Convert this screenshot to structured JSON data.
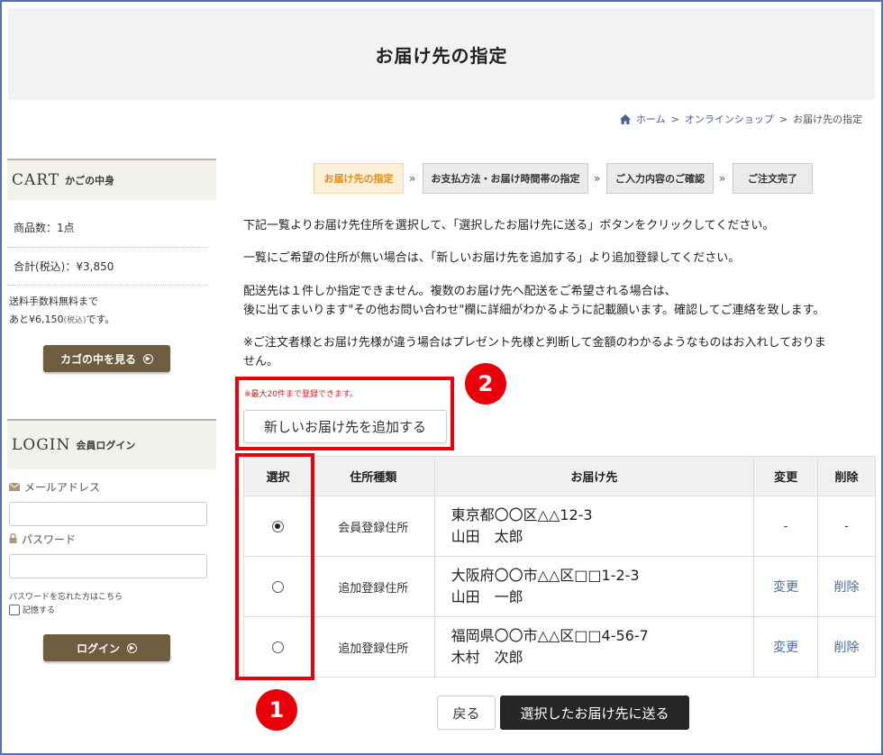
{
  "header": {
    "title": "お届け先の指定"
  },
  "breadcrumb": {
    "home": "ホーム",
    "sep1": ">",
    "shop": "オンラインショップ",
    "sep2": ">",
    "current": "お届け先の指定"
  },
  "sidebar": {
    "cart": {
      "title": "CART",
      "subtitle": "かごの中身",
      "item_count": "商品数：1点",
      "total": "合計(税込)：¥3,850",
      "shipping_line1": "送料手数料無料まで",
      "shipping_line2_prefix": "あと¥6,150",
      "shipping_line2_tax": "(税込)",
      "shipping_line2_suffix": "です。",
      "view_cart_button": "カゴの中を見る"
    },
    "login": {
      "title": "LOGIN",
      "subtitle": "会員ログイン",
      "email_label": "メールアドレス",
      "password_label": "パスワード",
      "forgot_link": "パスワードを忘れた方はこちら",
      "remember_label": "記憶する",
      "login_button": "ログイン"
    }
  },
  "steps": [
    {
      "label": "お届け先の指定",
      "active": true
    },
    {
      "label": "お支払方法・お届け時間帯の指定",
      "active": false
    },
    {
      "label": "ご入力内容のご確認",
      "active": false
    },
    {
      "label": "ご注文完了",
      "active": false
    }
  ],
  "step_separator": "»",
  "instructions": {
    "p1": "下記一覧よりお届け先住所を選択して、「選択したお届け先に送る」ボタンをクリックしてください。",
    "p2": "一覧にご希望の住所が無い場合は、「新しいお届け先を追加する」より追加登録してください。",
    "p3_line1": "配送先は１件しか指定できません。複数のお届け先へ配送をご希望される場合は、",
    "p3_line2": "後に出てまいります\"その他お問い合わせ\"欄に詳細がわかるように記載願います。確認してご連絡を致します。",
    "p4_line1": "※ご注文者様とお届け先様が違う場合はプレゼント先様と判断して金額のわかるようなものはお入れしておりま",
    "p4_line2": "せん。"
  },
  "max_note": "※最大20件まで登録できます。",
  "add_address_button": "新しいお届け先を追加する",
  "table": {
    "headers": {
      "select": "選択",
      "type": "住所種類",
      "destination": "お届け先",
      "edit": "変更",
      "delete": "削除"
    },
    "rows": [
      {
        "selected": true,
        "type": "会員登録住所",
        "address": "東京都〇〇区△△12-3",
        "name": "山田　太郎",
        "edit": "-",
        "delete": "-"
      },
      {
        "selected": false,
        "type": "追加登録住所",
        "address": "大阪府〇〇市△△区□□1-2-3",
        "name": "山田　一郎",
        "edit": "変更",
        "delete": "削除"
      },
      {
        "selected": false,
        "type": "追加登録住所",
        "address": "福岡県〇〇市△△区□□4-56-7",
        "name": "木村　次郎",
        "edit": "変更",
        "delete": "削除"
      }
    ]
  },
  "buttons": {
    "back": "戻る",
    "send": "選択したお届け先に送る"
  },
  "annotations": {
    "badge1": "1",
    "badge2": "2"
  },
  "colors": {
    "annotation_red": "#e8000b",
    "active_step": "#e38a1b",
    "brown_button": "#6e5d3e",
    "link_blue": "#4a6a99"
  }
}
